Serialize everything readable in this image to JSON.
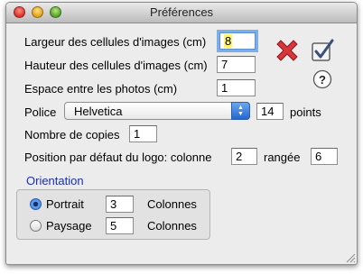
{
  "window": {
    "title": "Préférences"
  },
  "fields": {
    "largeur": {
      "label": "Largeur des cellules d'images (cm)",
      "value": "8"
    },
    "hauteur": {
      "label": "Hauteur des cellules d'images (cm)",
      "value": "7"
    },
    "espace": {
      "label": "Espace entre les photos (cm)",
      "value": "1"
    },
    "police": {
      "label": "Police",
      "value": "Helvetica",
      "size": "14",
      "unit": "points"
    },
    "copies": {
      "label": "Nombre de copies",
      "value": "1"
    },
    "logo": {
      "label": "Position par défaut du logo: colonne",
      "colonne": "2",
      "rangee_label": "rangée",
      "rangee": "6"
    }
  },
  "orientation": {
    "title": "Orientation",
    "portrait": {
      "label": "Portrait",
      "value": "3",
      "unit": "Colonnes",
      "selected": true
    },
    "paysage": {
      "label": "Paysage",
      "value": "5",
      "unit": "Colonnes",
      "selected": false
    }
  },
  "icons": {
    "cancel": "red-x-icon",
    "confirm": "checkbox-check-icon",
    "help": "help-icon"
  },
  "colors": {
    "accent": "#2c6fd4",
    "group_title": "#1c2fae",
    "cancel": "#d9353a"
  }
}
